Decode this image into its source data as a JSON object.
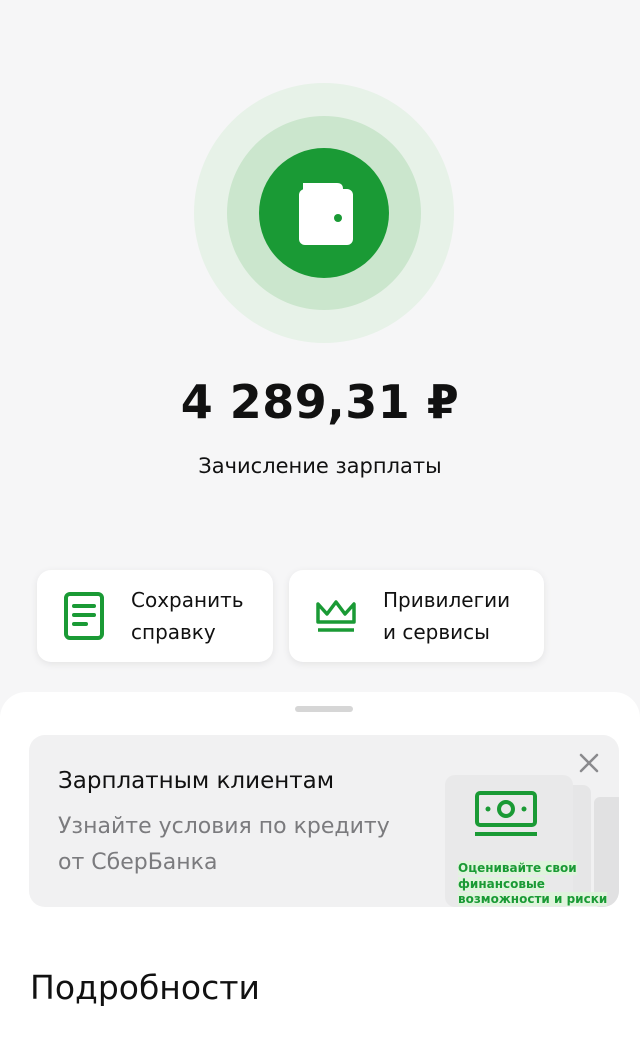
{
  "hero": {
    "icon": "wallet-icon",
    "amount": "4 289,31 ₽",
    "description": "Зачисление зарплаты",
    "accent_color": "#1a9a35"
  },
  "actions": [
    {
      "label": "Сохранить справку",
      "icon": "document-icon"
    },
    {
      "label": "Привилегии и сервисы",
      "icon": "crown-icon"
    }
  ],
  "promo": {
    "title": "Зарплатным клиентам",
    "text": "Узнайте условия по кредиту от СберБанка",
    "art_caption": "Оценивайте свои финансовые возможности и риски",
    "close_icon": "close-icon"
  },
  "details": {
    "title": "Подробности"
  }
}
